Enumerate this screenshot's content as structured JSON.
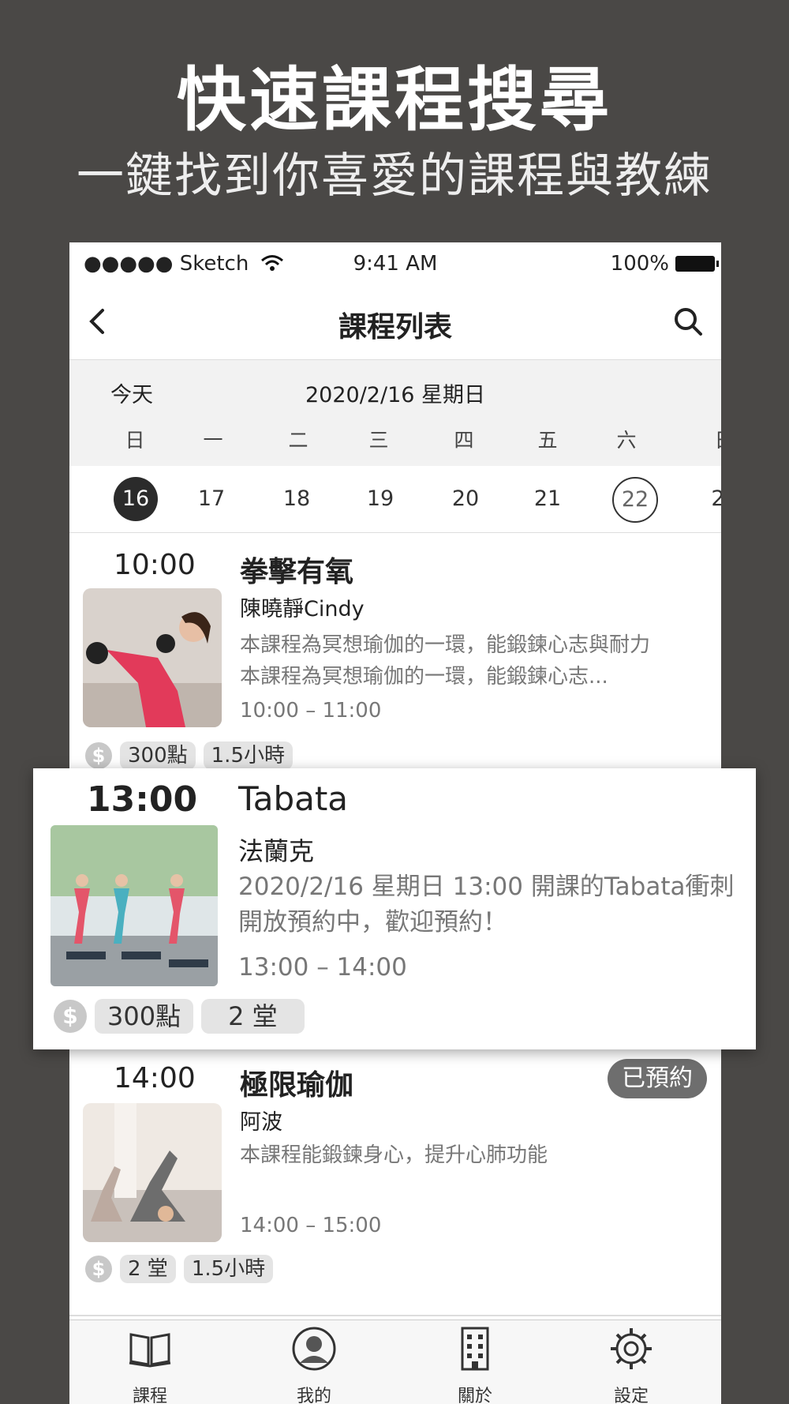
{
  "hero": {
    "title": "快速課程搜尋",
    "subtitle": "一鍵找到你喜愛的課程與教練"
  },
  "status_bar": {
    "carrier": "●●●●● Sketch",
    "time": "9:41 AM",
    "battery": "100%"
  },
  "nav": {
    "title": "課程列表"
  },
  "calendar": {
    "today_label": "今天",
    "current_date": "2020/2/16 星期日",
    "weekdays": [
      "日",
      "一",
      "二",
      "三",
      "四",
      "五",
      "六",
      "日"
    ],
    "days": [
      "16",
      "17",
      "18",
      "19",
      "20",
      "21",
      "22",
      "2"
    ]
  },
  "courses": [
    {
      "time": "10:00",
      "name": "拳擊有氧",
      "coach": "陳曉靜Cindy",
      "desc_line1": "本課程為冥想瑜伽的一環，能鍛鍊心志與耐力",
      "desc_line2": "本課程為冥想瑜伽的一環，能鍛鍊心志...",
      "slot": "10:00 – 11:00",
      "tag1": "300點",
      "tag2": "1.5小時"
    },
    {
      "time": "13:00",
      "name": "Tabata",
      "coach": "法蘭克",
      "desc_line1": "2020/2/16 星期日 13:00 開課的Tabata衝刺",
      "desc_line2": "開放預約中，歡迎預約！",
      "slot": "13:00 – 14:00",
      "tag1": "300點",
      "tag2": "2 堂"
    },
    {
      "time": "14:00",
      "name": "極限瑜伽",
      "coach": "阿波",
      "desc_line1": "本課程能鍛鍊身心，提升心肺功能",
      "slot": "14:00 – 15:00",
      "badge": "已預約",
      "tag1": "2 堂",
      "tag2": "1.5小時"
    }
  ],
  "coin_symbol": "$",
  "tabbar": {
    "courses": "課程",
    "mine": "我的",
    "about": "關於",
    "settings": "設定"
  }
}
